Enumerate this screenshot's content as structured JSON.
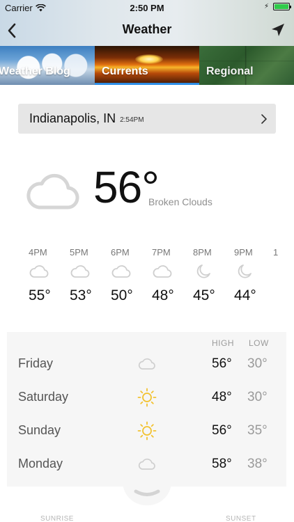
{
  "status_bar": {
    "carrier": "Carrier",
    "time": "2:50 PM"
  },
  "nav": {
    "title": "Weather",
    "back_icon": "chevron-left-icon",
    "location_icon": "location-arrow-icon"
  },
  "tabs": [
    {
      "label": "Weather Blog",
      "selected": false
    },
    {
      "label": "Currents",
      "selected": true
    },
    {
      "label": "Regional",
      "selected": false
    }
  ],
  "location": {
    "name": "Indianapolis, IN",
    "updated": "2:54PM"
  },
  "current": {
    "temp": "56°",
    "condition": "Broken Clouds",
    "icon": "cloud-icon"
  },
  "hourly": [
    {
      "time": "4PM",
      "icon": "cloud-icon",
      "temp": "55°"
    },
    {
      "time": "5PM",
      "icon": "cloud-icon",
      "temp": "53°"
    },
    {
      "time": "6PM",
      "icon": "cloud-icon",
      "temp": "50°"
    },
    {
      "time": "7PM",
      "icon": "cloud-icon",
      "temp": "48°"
    },
    {
      "time": "8PM",
      "icon": "moon-icon",
      "temp": "45°"
    },
    {
      "time": "9PM",
      "icon": "moon-icon",
      "temp": "44°"
    },
    {
      "time": "1",
      "icon": "",
      "temp": ""
    }
  ],
  "daily": {
    "high_header": "HIGH",
    "low_header": "LOW",
    "days": [
      {
        "name": "Friday",
        "icon": "cloud-icon",
        "high": "56°",
        "low": "30°"
      },
      {
        "name": "Saturday",
        "icon": "sun-icon",
        "high": "48°",
        "low": "30°"
      },
      {
        "name": "Sunday",
        "icon": "sun-icon",
        "high": "56°",
        "low": "35°"
      },
      {
        "name": "Monday",
        "icon": "cloud-icon",
        "high": "58°",
        "low": "38°"
      }
    ]
  },
  "bottom": {
    "sunrise_label": "SUNRISE",
    "sunset_label": "SUNSET"
  },
  "colors": {
    "accent": "#2f8fe6",
    "sun": "#f2c230",
    "icon_gray": "#cfcfcf"
  }
}
